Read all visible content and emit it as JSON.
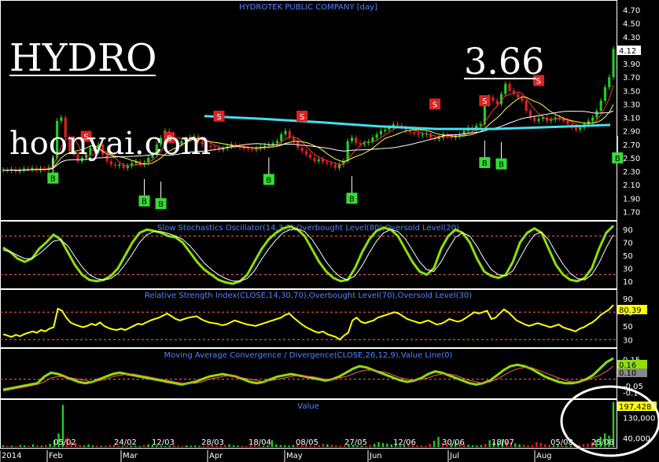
{
  "window_title": "HYDROTEK PUBLIC COMPANY [day]",
  "overlay": {
    "symbol": "HYDRO",
    "price": "3.66",
    "website": "hoonyai.com"
  },
  "colors": {
    "background": "#000000",
    "up_candle": "#22cc22",
    "down_candle": "#e02020",
    "long_ma": "#40e0f0",
    "stoch": "#8fe000",
    "rsi": "#ffff00",
    "macd": "#8fe000",
    "volume_up": "#22cc22",
    "volume_down": "#e02020",
    "buy_signal": "#33dd33",
    "sell_signal": "#dd2222",
    "panel_title": "#4f86ff",
    "circle": "#ffffff"
  },
  "chart_data": [
    {
      "type": "candlestick",
      "panel": "price",
      "title": "HYDROTEK PUBLIC COMPANY [day]",
      "ylim": [
        1.6,
        4.8
      ],
      "y_ticks": [
        "4.70",
        "4.50",
        "4.30",
        "4.10",
        "3.90",
        "3.70",
        "3.50",
        "3.30",
        "3.10",
        "2.90",
        "2.70",
        "2.50",
        "2.30",
        "2.10",
        "1.90",
        "1.70"
      ],
      "last_value": "4.12",
      "close": [
        2.32,
        2.31,
        2.33,
        2.3,
        2.32,
        2.34,
        2.33,
        2.35,
        2.32,
        2.34,
        2.33,
        2.36,
        2.5,
        3.05,
        3.1,
        2.8,
        2.6,
        2.55,
        2.45,
        2.5,
        2.55,
        2.65,
        2.6,
        2.7,
        2.55,
        2.45,
        2.4,
        2.38,
        2.4,
        2.35,
        2.38,
        2.42,
        2.45,
        2.4,
        2.43,
        2.5,
        2.55,
        2.7,
        2.8,
        2.9,
        2.85,
        2.75,
        2.7,
        2.75,
        2.78,
        2.8,
        2.82,
        2.75,
        2.7,
        2.68,
        2.66,
        2.65,
        2.62,
        2.64,
        2.67,
        2.7,
        2.68,
        2.66,
        2.64,
        2.63,
        2.62,
        2.64,
        2.66,
        2.68,
        2.7,
        2.72,
        2.75,
        2.85,
        2.9,
        2.8,
        2.75,
        2.65,
        2.6,
        2.55,
        2.5,
        2.45,
        2.48,
        2.44,
        2.42,
        2.4,
        2.35,
        2.4,
        2.45,
        2.75,
        2.8,
        2.72,
        2.7,
        2.72,
        2.74,
        2.8,
        2.85,
        2.9,
        2.92,
        2.95,
        3.0,
        2.98,
        2.95,
        2.9,
        2.88,
        2.86,
        2.84,
        2.85,
        2.86,
        2.8,
        2.78,
        2.8,
        2.85,
        2.82,
        2.8,
        2.82,
        2.85,
        2.9,
        2.95,
        2.92,
        2.98,
        3.0,
        3.3,
        3.4,
        3.35,
        3.3,
        3.45,
        3.6,
        3.5,
        3.45,
        3.4,
        3.35,
        3.2,
        3.1,
        3.05,
        3.08,
        3.1,
        3.05,
        3.07,
        3.1,
        3.08,
        3.05,
        3.0,
        2.95,
        2.92,
        2.95,
        3.0,
        3.05,
        3.1,
        3.2,
        3.35,
        3.55,
        3.7,
        4.12
      ],
      "overlays": [
        {
          "name": "long_ma",
          "type": "line",
          "values": [
            3.12,
            3.08,
            3.03,
            2.97,
            2.93,
            2.93,
            2.96,
            2.99
          ]
        }
      ],
      "signals": [
        {
          "type": "buy",
          "label": "B",
          "index": 12,
          "value": 2.2
        },
        {
          "type": "buy",
          "label": "B",
          "index": 34,
          "value": 1.86
        },
        {
          "type": "buy",
          "label": "B",
          "index": 38,
          "value": 1.82
        },
        {
          "type": "buy",
          "label": "B",
          "index": 64,
          "value": 2.18
        },
        {
          "type": "buy",
          "label": "B",
          "index": 84,
          "value": 1.9
        },
        {
          "type": "buy",
          "label": "B",
          "index": 116,
          "value": 2.43
        },
        {
          "type": "buy",
          "label": "B",
          "index": 120,
          "value": 2.41
        },
        {
          "type": "buy",
          "label": "B",
          "index": 148,
          "value": 2.5
        },
        {
          "type": "sell",
          "label": "S",
          "index": 20,
          "value": 2.82
        },
        {
          "type": "sell",
          "label": "S",
          "index": 40,
          "value": 2.8
        },
        {
          "type": "sell",
          "label": "S",
          "index": 52,
          "value": 3.12
        },
        {
          "type": "sell",
          "label": "S",
          "index": 72,
          "value": 3.12
        },
        {
          "type": "sell",
          "label": "S",
          "index": 104,
          "value": 3.3
        },
        {
          "type": "sell",
          "label": "S",
          "index": 116,
          "value": 3.35
        },
        {
          "type": "sell",
          "label": "S",
          "index": 129,
          "value": 3.65
        }
      ]
    },
    {
      "type": "line",
      "panel": "stochastic",
      "title": "Slow Stochastics Oscillator(14,3,3),Overbought Level(80),Oversold Level(20)",
      "ylim": [
        0,
        100
      ],
      "y_ticks": [
        "90",
        "70",
        "50",
        "30",
        "10"
      ],
      "overbought": 80,
      "oversold": 20,
      "series": [
        {
          "values": [
            62,
            55,
            45,
            40,
            45,
            60,
            70,
            82,
            75,
            55,
            35,
            20,
            12,
            10,
            12,
            18,
            30,
            50,
            70,
            85,
            90,
            88,
            85,
            80,
            78,
            70,
            55,
            40,
            28,
            20,
            12,
            8,
            6,
            10,
            20,
            40,
            60,
            75,
            85,
            92,
            95,
            90,
            80,
            60,
            40,
            25,
            15,
            10,
            12,
            30,
            55,
            75,
            88,
            93,
            90,
            80,
            60,
            40,
            25,
            20,
            30,
            60,
            80,
            90,
            85,
            70,
            45,
            25,
            18,
            15,
            20,
            40,
            70,
            85,
            92,
            85,
            60,
            35,
            20,
            12,
            10,
            15,
            30,
            60,
            85,
            96
          ]
        },
        {
          "values": [
            58,
            56,
            50,
            45,
            45,
            52,
            62,
            72,
            74,
            65,
            48,
            32,
            20,
            14,
            12,
            14,
            22,
            36,
            52,
            70,
            82,
            87,
            87,
            84,
            80,
            75,
            65,
            52,
            38,
            28,
            20,
            14,
            10,
            10,
            14,
            26,
            44,
            60,
            74,
            85,
            90,
            91,
            87,
            75,
            58,
            40,
            26,
            16,
            12,
            18,
            34,
            54,
            72,
            85,
            90,
            87,
            76,
            58,
            40,
            28,
            25,
            40,
            60,
            78,
            85,
            80,
            64,
            44,
            28,
            20,
            18,
            26,
            46,
            66,
            82,
            86,
            74,
            54,
            36,
            22,
            14,
            12,
            20,
            38,
            62,
            82
          ]
        }
      ]
    },
    {
      "type": "line",
      "panel": "rsi",
      "title": "Relative Strength Index(CLOSE,14,30,70),Overbought Level(70),Oversold Level(30)",
      "ylim": [
        20,
        100
      ],
      "y_ticks": [
        "90",
        "70",
        "50",
        "30"
      ],
      "overbought": 70,
      "oversold": 30,
      "last_value": "80.39",
      "series": [
        {
          "values": [
            38,
            36,
            34,
            37,
            35,
            38,
            40,
            42,
            40,
            44,
            42,
            46,
            48,
            75,
            72,
            62,
            55,
            52,
            50,
            48,
            50,
            53,
            51,
            55,
            50,
            47,
            45,
            44,
            46,
            44,
            47,
            50,
            53,
            52,
            55,
            58,
            60,
            62,
            65,
            68,
            64,
            60,
            58,
            60,
            62,
            63,
            64,
            60,
            57,
            55,
            54,
            53,
            51,
            52,
            55,
            58,
            56,
            54,
            52,
            51,
            50,
            52,
            54,
            56,
            58,
            60,
            62,
            66,
            68,
            62,
            57,
            52,
            48,
            45,
            42,
            40,
            42,
            38,
            36,
            34,
            30,
            36,
            40,
            58,
            62,
            56,
            54,
            56,
            58,
            62,
            64,
            66,
            68,
            70,
            68,
            64,
            60,
            58,
            56,
            54,
            56,
            58,
            55,
            52,
            53,
            56,
            60,
            58,
            56,
            58,
            62,
            66,
            70,
            68,
            70,
            72,
            60,
            62,
            68,
            74,
            70,
            64,
            58,
            55,
            52,
            50,
            52,
            54,
            52,
            50,
            48,
            50,
            52,
            48,
            46,
            44,
            42,
            46,
            48,
            52,
            55,
            60,
            66,
            70,
            74,
            80.39
          ]
        }
      ]
    },
    {
      "type": "line",
      "panel": "macd",
      "title": "Moving Average Convergence / Divergence(CLOSE,26,12,9),Value Line(0)",
      "ylim": [
        -0.14,
        0.22
      ],
      "y_ticks": [
        "0.15",
        "0.10",
        "0.05",
        "-0.05",
        "-0.1"
      ],
      "last_values": [
        "0.16",
        "0.10"
      ],
      "series": [
        {
          "values": [
            -0.08,
            -0.07,
            -0.06,
            -0.05,
            -0.04,
            -0.03,
            0.02,
            0.05,
            0.04,
            0.02,
            0.0,
            -0.02,
            -0.03,
            -0.02,
            0.0,
            0.02,
            0.04,
            0.05,
            0.04,
            0.03,
            0.02,
            0.01,
            0.0,
            -0.01,
            -0.02,
            -0.03,
            -0.04,
            -0.03,
            -0.02,
            0.0,
            0.02,
            0.03,
            0.04,
            0.03,
            0.02,
            0.0,
            -0.02,
            -0.03,
            -0.02,
            0.0,
            0.02,
            0.03,
            0.04,
            0.03,
            0.02,
            0.01,
            0.0,
            -0.01,
            0.0,
            0.02,
            0.05,
            0.08,
            0.1,
            0.09,
            0.07,
            0.05,
            0.03,
            0.01,
            -0.01,
            -0.02,
            -0.01,
            0.01,
            0.04,
            0.06,
            0.05,
            0.03,
            0.01,
            -0.01,
            -0.03,
            -0.04,
            -0.03,
            -0.01,
            0.03,
            0.07,
            0.1,
            0.11,
            0.1,
            0.08,
            0.05,
            0.02,
            0.0,
            -0.02,
            -0.03,
            -0.03,
            -0.02,
            0.0,
            0.03,
            0.08,
            0.13,
            0.16
          ]
        },
        {
          "values": [
            -0.09,
            -0.08,
            -0.07,
            -0.06,
            -0.05,
            -0.04,
            -0.02,
            0.01,
            0.02,
            0.02,
            0.01,
            0.0,
            -0.01,
            -0.02,
            -0.01,
            0.0,
            0.02,
            0.03,
            0.04,
            0.04,
            0.03,
            0.02,
            0.01,
            0.0,
            -0.01,
            -0.02,
            -0.03,
            -0.03,
            -0.03,
            -0.02,
            0.0,
            0.01,
            0.02,
            0.03,
            0.02,
            0.01,
            0.0,
            -0.01,
            -0.02,
            -0.01,
            0.0,
            0.01,
            0.02,
            0.03,
            0.02,
            0.02,
            0.01,
            0.0,
            0.0,
            0.01,
            0.02,
            0.04,
            0.06,
            0.07,
            0.07,
            0.06,
            0.05,
            0.03,
            0.01,
            0.0,
            -0.01,
            0.0,
            0.01,
            0.03,
            0.04,
            0.04,
            0.03,
            0.01,
            -0.01,
            -0.02,
            -0.03,
            -0.02,
            0.0,
            0.03,
            0.06,
            0.08,
            0.09,
            0.09,
            0.07,
            0.05,
            0.03,
            0.01,
            -0.01,
            -0.02,
            -0.02,
            -0.01,
            0.01,
            0.03,
            0.06,
            0.1
          ]
        }
      ]
    },
    {
      "type": "bar",
      "panel": "volume",
      "title": "Value",
      "ylim": [
        0,
        200000
      ],
      "y_ticks": [
        "130,000",
        "40,000"
      ],
      "last_value": "197,428",
      "values": [
        8000,
        5000,
        6000,
        4000,
        9000,
        7000,
        5000,
        12000,
        8000,
        6000,
        9000,
        14000,
        30000,
        60000,
        185000,
        40000,
        22000,
        18000,
        9000,
        7000,
        12000,
        8000,
        6000,
        5000,
        7000,
        9000,
        11000,
        6000,
        5000,
        8000,
        7000,
        6000,
        5000,
        9000,
        12000,
        10000,
        8000,
        6000,
        5000,
        7000,
        9000,
        6000,
        5000,
        8000,
        6000,
        7000,
        5000,
        6000,
        9000,
        8000,
        7000,
        6000,
        10000,
        12000,
        8000,
        7000,
        6000,
        5000,
        9000,
        11000,
        7000,
        6000,
        8000,
        30000,
        12000,
        9000,
        8000,
        7000,
        10000,
        12000,
        9000,
        8000,
        7000,
        6000,
        9000,
        14000,
        12000,
        10000,
        8000,
        7000,
        9000,
        12000,
        10000,
        8000,
        7000,
        6000,
        9000,
        14000,
        22000,
        18000,
        15000,
        12000,
        10000,
        8000,
        9000,
        12000,
        10000,
        8000,
        7000,
        6000,
        14000,
        28000,
        45000,
        18000,
        15000,
        12000,
        22000,
        18000,
        12000,
        10000,
        8000,
        7000,
        9000,
        14000,
        30000,
        22000,
        18000,
        35000,
        26000,
        20000,
        16000,
        12000,
        10000,
        8000,
        9000,
        22000,
        18000,
        12000,
        10000,
        8000,
        9000,
        7000,
        6000,
        8000,
        9000,
        10000,
        12000,
        15000,
        20000,
        30000,
        45000,
        60000,
        50000,
        197428
      ],
      "colors_up_down": "alternating by close change"
    }
  ],
  "x_axis": {
    "top_row": [
      "05/02",
      "24/02",
      "12/03",
      "28/03",
      "18/04",
      "08/05",
      "27/05",
      "12/06",
      "30/06",
      "18/07",
      "05/08",
      "25/08"
    ],
    "bottom_row": [
      "2014",
      "Feb",
      "Mar",
      "Apr",
      "May",
      "Jun",
      "Jul",
      "Aug"
    ]
  }
}
